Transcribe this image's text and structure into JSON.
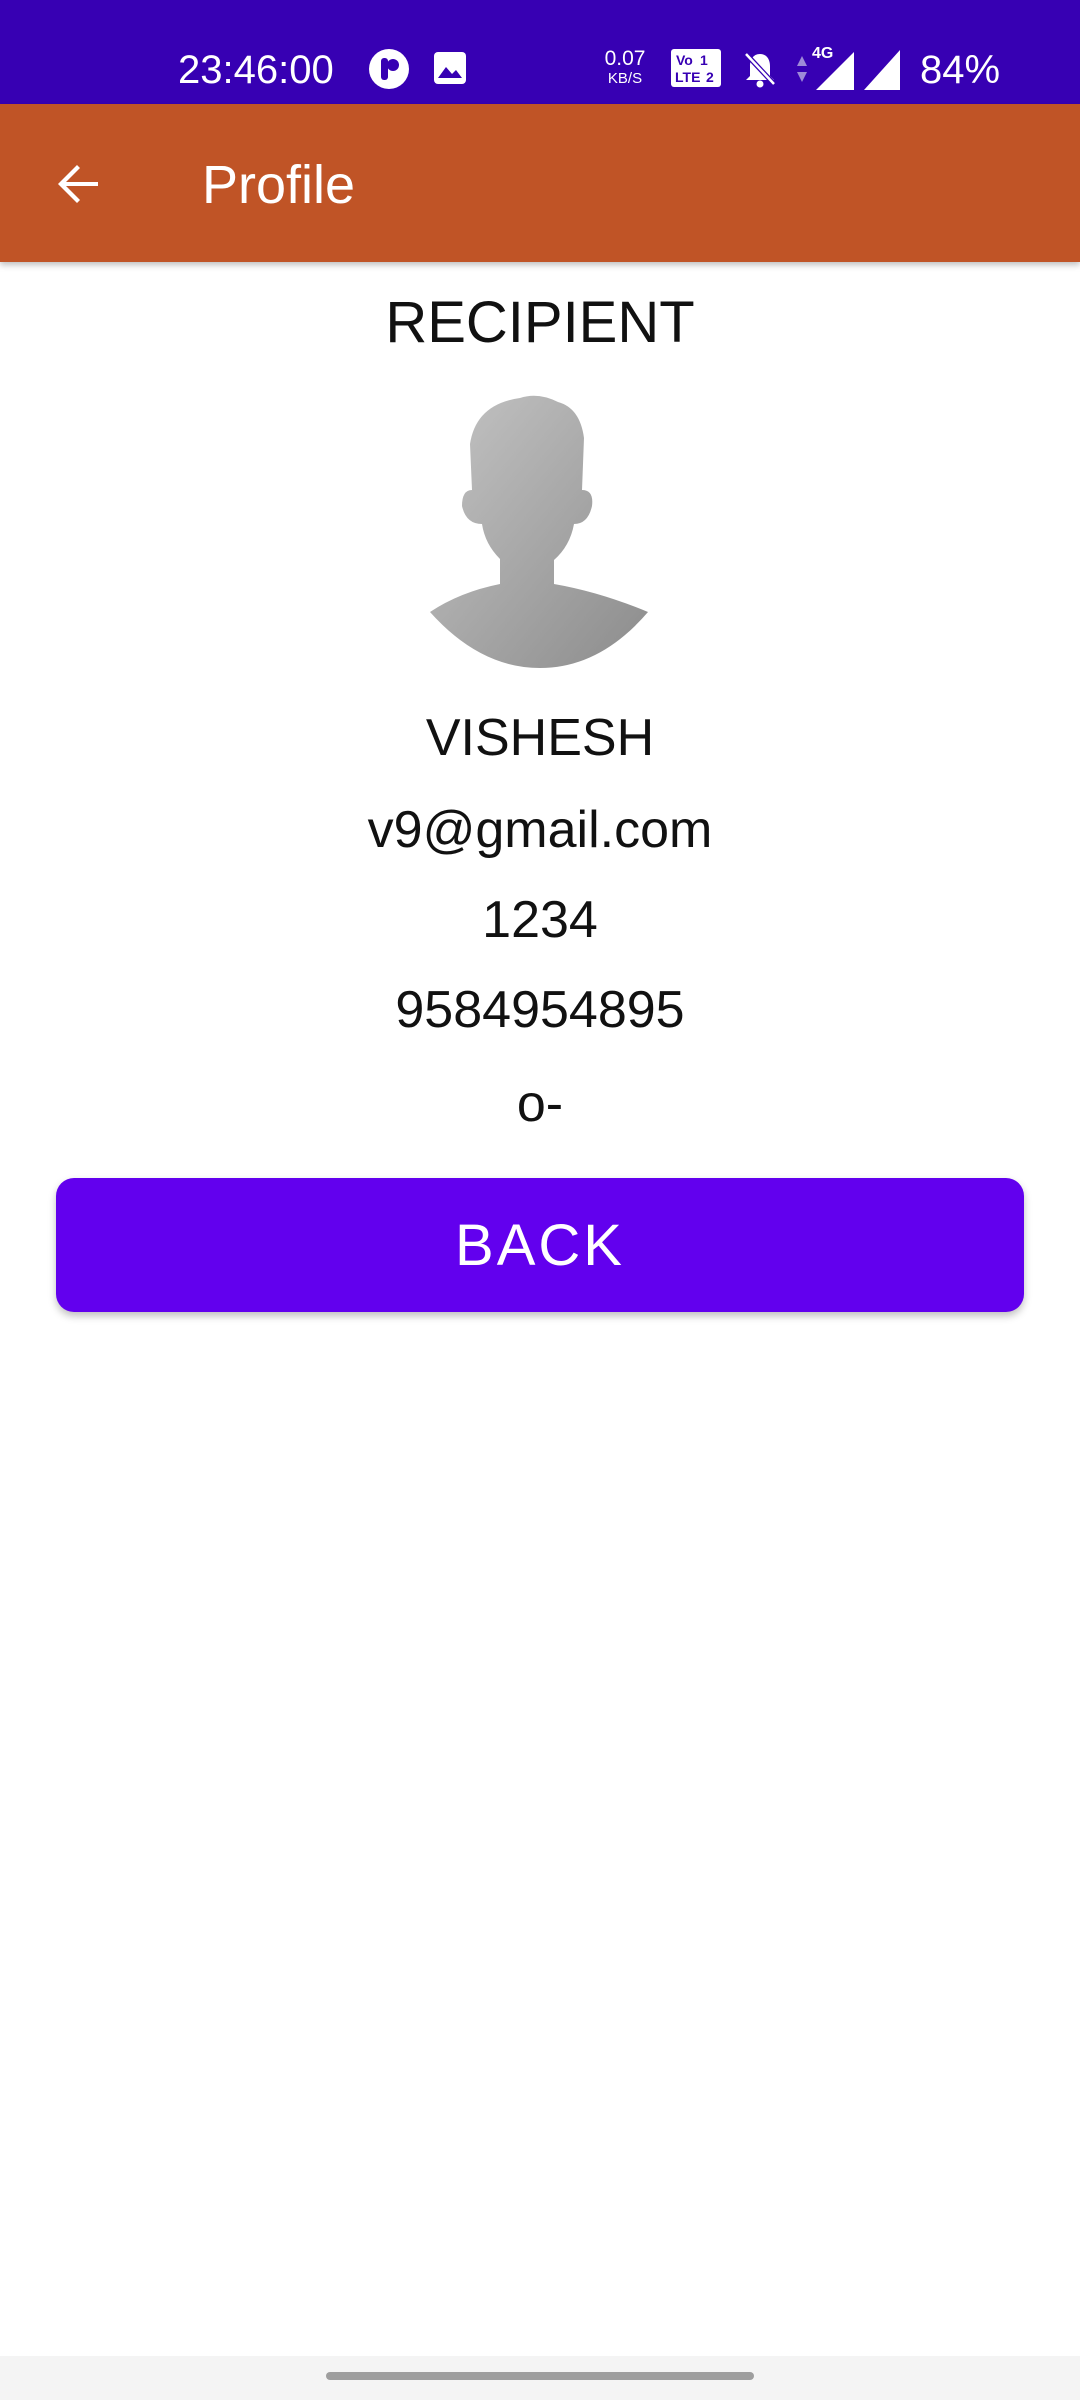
{
  "status_bar": {
    "time": "23:46:00",
    "net_speed_value": "0.07",
    "net_speed_unit": "KB/S",
    "volte_label": "Vo LTE",
    "network_type": "4G",
    "battery": "84%",
    "icons": [
      "app-notification-icon",
      "image-icon",
      "volte-icon",
      "mute-bell-icon",
      "data-arrows-icon",
      "signal-4g-icon",
      "signal-icon"
    ]
  },
  "app_bar": {
    "title": "Profile",
    "back_icon": "arrow-back-icon",
    "color": "#C05426"
  },
  "profile": {
    "role": "RECIPIENT",
    "avatar_icon": "person-silhouette-icon",
    "name": "VISHESH",
    "email": "v9@gmail.com",
    "password": "1234",
    "phone": "9584954895",
    "blood_group": "o-"
  },
  "actions": {
    "back_label": "BACK",
    "back_color": "#6200EE"
  },
  "colors": {
    "status_bar": "#3700B3"
  }
}
